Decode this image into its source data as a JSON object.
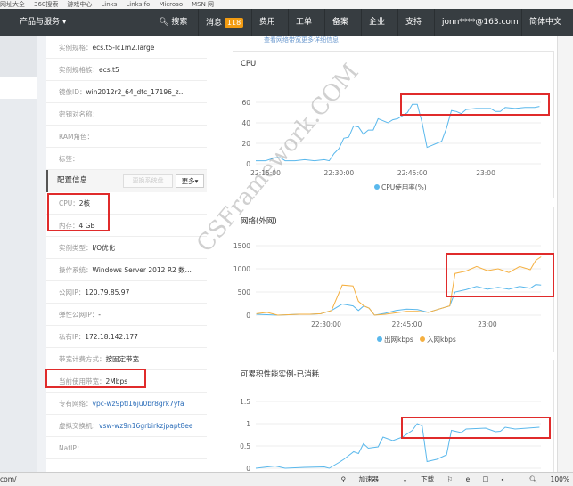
{
  "bookmarks": [
    "网址大全",
    "360搜索",
    "游戏中心",
    "Links",
    "Links fo",
    "Microso",
    "MSN 网"
  ],
  "nav": {
    "products": "产品与服务 ▾",
    "search": "搜索",
    "messages": "消息",
    "message_count": "118",
    "billing": "费用",
    "tickets": "工单",
    "icp": "备案",
    "enterprise": "企业",
    "support": "支持",
    "user": "jonn****@163.com",
    "lang": "简体中文"
  },
  "top_link": "查看网络带宽更多详细信息",
  "info_rows": [
    {
      "k": "实例规格：",
      "v": "ecs.t5-lc1m2.large"
    },
    {
      "k": "实例规格族：",
      "v": "ecs.t5"
    },
    {
      "k": "镜像ID：",
      "v": "win2012r2_64_dtc_17196_z..."
    },
    {
      "k": "密钥对名称：",
      "v": ""
    },
    {
      "k": "RAM角色：",
      "v": ""
    },
    {
      "k": "标签：",
      "v": ""
    }
  ],
  "config": {
    "title": "配置信息",
    "replace_disk": "更换系统盘",
    "more": "更多▾"
  },
  "config_rows": [
    {
      "k": "CPU：",
      "v": "2核"
    },
    {
      "k": "内存：",
      "v": "4 GB"
    },
    {
      "k": "实例类型：",
      "v": "I/O优化"
    },
    {
      "k": "操作系统：",
      "v": "Windows Server 2012 R2 数..."
    },
    {
      "k": "公网IP：",
      "v": "120.79.85.97"
    },
    {
      "k": "弹性公网IP：",
      "v": "-"
    },
    {
      "k": "私有IP：",
      "v": "172.18.142.177"
    },
    {
      "k": "带宽计费方式：",
      "v": "按固定带宽"
    },
    {
      "k": "当前使用带宽：",
      "v": "2Mbps"
    },
    {
      "k": "专有网络：",
      "v": "vpc-wz9ptl16ju0br8grk7yfa",
      "link": true
    },
    {
      "k": "虚拟交换机：",
      "v": "vsw-wz9n16grbirkzjpapt8ee",
      "link": true
    },
    {
      "k": "NatIP：",
      "v": ""
    }
  ],
  "watermark": "CSFramework.COM",
  "status": {
    "url": "com/",
    "accelerator": "加速器",
    "download": "下载",
    "zoom": "100%"
  },
  "colors": {
    "blue": "#5ab8ec",
    "orange": "#f5b041",
    "highlight": "#e02b2b",
    "nav": "#373d41"
  },
  "chart_data": [
    {
      "type": "line",
      "title": "CPU",
      "ylim": [
        0,
        60
      ],
      "yticks": [
        0,
        20,
        40,
        60
      ],
      "xticks": [
        "22:15:00",
        "22:30:00",
        "22:45:00",
        "23:00"
      ],
      "x": [
        "22:13",
        "22:15",
        "22:17",
        "22:18",
        "22:19",
        "22:21",
        "22:23",
        "22:25",
        "22:27",
        "22:28",
        "22:29",
        "22:30",
        "22:31",
        "22:32",
        "22:33",
        "22:34",
        "22:35",
        "22:36",
        "22:37",
        "22:38",
        "22:39",
        "22:40",
        "22:41",
        "22:42",
        "22:43",
        "22:44",
        "22:45",
        "22:46",
        "22:47",
        "22:48",
        "22:49",
        "22:50",
        "22:51",
        "22:52",
        "22:53",
        "22:54",
        "22:55",
        "22:56",
        "22:58",
        "23:00",
        "23:01",
        "23:02",
        "23:03",
        "23:04",
        "23:06",
        "23:08",
        "23:10",
        "23:11"
      ],
      "series": [
        {
          "name": "CPU使用率(%)",
          "color": "#5ab8ec",
          "values": [
            3,
            3,
            6,
            6,
            3,
            3,
            4,
            3,
            4,
            3,
            10,
            15,
            25,
            26,
            37,
            36,
            29,
            33,
            33,
            44,
            42,
            40,
            43,
            44,
            47,
            50,
            58,
            58,
            40,
            16,
            18,
            20,
            22,
            35,
            52,
            51,
            49,
            53,
            54,
            54,
            54,
            51,
            51,
            55,
            54,
            55,
            55,
            56
          ]
        }
      ]
    },
    {
      "type": "line",
      "title": "网络(外网)",
      "ylim": [
        0,
        1500
      ],
      "yticks": [
        0,
        500,
        1000,
        1500
      ],
      "xticks": [
        "22:30:00",
        "22:45:00",
        "23:00"
      ],
      "x": [
        "22:17",
        "22:19",
        "22:21",
        "22:23",
        "22:25",
        "22:27",
        "22:29",
        "22:31",
        "22:33",
        "22:35",
        "22:36",
        "22:37",
        "22:38",
        "22:39",
        "22:41",
        "22:43",
        "22:45",
        "22:47",
        "22:49",
        "22:51",
        "22:53",
        "22:54",
        "22:56",
        "22:58",
        "23:00",
        "23:02",
        "23:04",
        "23:06",
        "23:08",
        "23:09",
        "23:10"
      ],
      "series": [
        {
          "name": "出网kbps",
          "color": "#5ab8ec",
          "values": [
            20,
            10,
            0,
            10,
            20,
            20,
            30,
            100,
            240,
            200,
            100,
            200,
            150,
            0,
            40,
            100,
            130,
            120,
            60,
            130,
            200,
            500,
            550,
            620,
            560,
            600,
            560,
            620,
            580,
            660,
            650
          ]
        },
        {
          "name": "入网kbps",
          "color": "#f5b041",
          "values": [
            30,
            60,
            0,
            10,
            20,
            20,
            30,
            100,
            650,
            630,
            300,
            200,
            150,
            0,
            20,
            50,
            80,
            80,
            60,
            130,
            200,
            900,
            950,
            1050,
            960,
            1000,
            920,
            1050,
            980,
            1180,
            1260
          ]
        }
      ]
    },
    {
      "type": "line",
      "title": "可累积性能实例-已消耗",
      "ylim": [
        0,
        1.5
      ],
      "yticks": [
        0,
        0.5,
        1,
        1.5
      ],
      "xticks": [],
      "x": [
        "22:13",
        "22:17",
        "22:19",
        "22:23",
        "22:27",
        "22:28",
        "22:30",
        "22:31",
        "22:33",
        "22:34",
        "22:35",
        "22:36",
        "22:38",
        "22:39",
        "22:41",
        "22:43",
        "22:45",
        "22:46",
        "22:47",
        "22:48",
        "22:50",
        "22:52",
        "22:53",
        "22:55",
        "22:56",
        "23:00",
        "23:02",
        "23:03",
        "23:04",
        "23:06",
        "23:11"
      ],
      "series": [
        {
          "name": "",
          "color": "#5ab8ec",
          "values": [
            0,
            0.05,
            0,
            0.02,
            0.03,
            0,
            0.13,
            0.2,
            0.37,
            0.33,
            0.55,
            0.45,
            0.48,
            0.7,
            0.62,
            0.7,
            0.85,
            1,
            0.95,
            0.15,
            0.2,
            0.3,
            0.85,
            0.8,
            0.88,
            0.9,
            0.82,
            0.83,
            0.92,
            0.88,
            0.92
          ]
        }
      ]
    }
  ]
}
